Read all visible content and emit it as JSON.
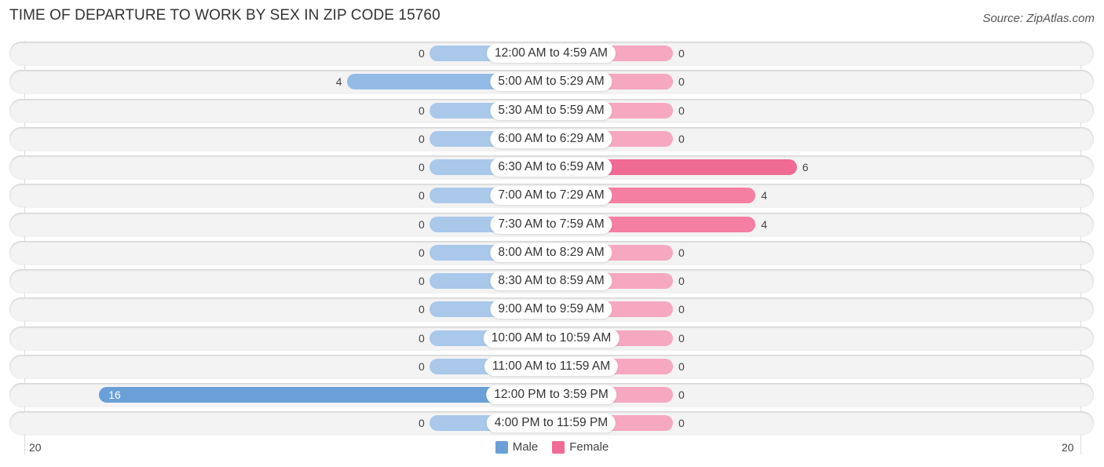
{
  "header": {
    "title": "TIME OF DEPARTURE TO WORK BY SEX IN ZIP CODE 15760",
    "source": "Source: ZipAtlas.com"
  },
  "colors": {
    "male": "#6a9fd8",
    "male_light": "#a9c8ea",
    "female": "#f06b94",
    "female_light": "#f6a8c0"
  },
  "chart_data": {
    "type": "bar",
    "orientation": "horizontal-diverging",
    "title": "TIME OF DEPARTURE TO WORK BY SEX IN ZIP CODE 15760",
    "categories": [
      "12:00 AM to 4:59 AM",
      "5:00 AM to 5:29 AM",
      "5:30 AM to 5:59 AM",
      "6:00 AM to 6:29 AM",
      "6:30 AM to 6:59 AM",
      "7:00 AM to 7:29 AM",
      "7:30 AM to 7:59 AM",
      "8:00 AM to 8:29 AM",
      "8:30 AM to 8:59 AM",
      "9:00 AM to 9:59 AM",
      "10:00 AM to 10:59 AM",
      "11:00 AM to 11:59 AM",
      "12:00 PM to 3:59 PM",
      "4:00 PM to 11:59 PM"
    ],
    "series": [
      {
        "name": "Male",
        "values": [
          0,
          4,
          0,
          0,
          0,
          0,
          0,
          0,
          0,
          0,
          0,
          0,
          16,
          0
        ]
      },
      {
        "name": "Female",
        "values": [
          0,
          0,
          0,
          0,
          6,
          4,
          4,
          0,
          0,
          0,
          0,
          0,
          0,
          0
        ]
      }
    ],
    "axis_ticks": {
      "left": "20",
      "right": "20"
    },
    "xlim": [
      -20,
      20
    ],
    "legend": {
      "position": "bottom-center",
      "entries": [
        "Male",
        "Female"
      ]
    },
    "grid": false
  }
}
